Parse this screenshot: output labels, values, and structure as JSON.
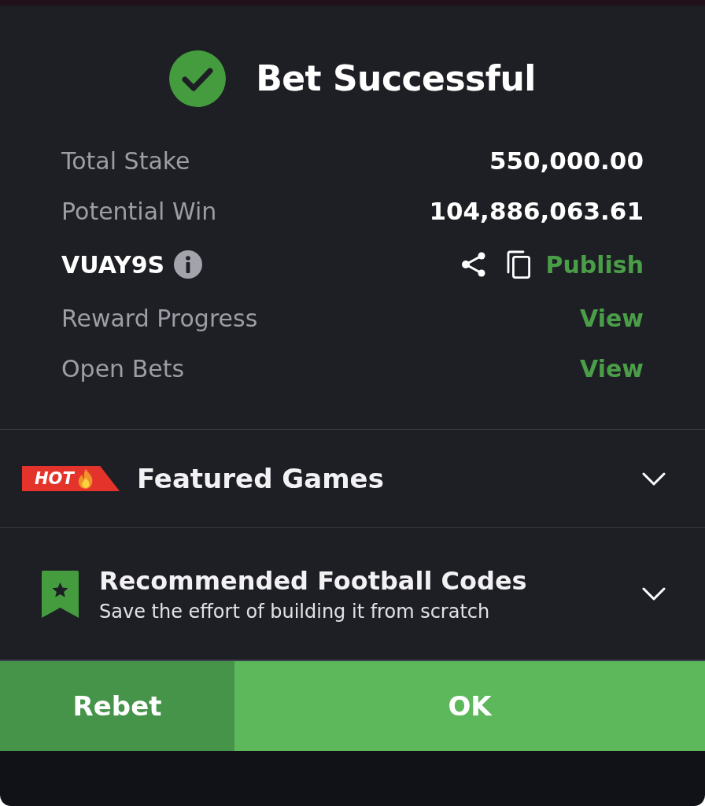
{
  "header": {
    "title": "Bet Successful"
  },
  "summary": [
    {
      "kind": "amount",
      "label": "Total Stake",
      "value": "550,000.00"
    },
    {
      "kind": "amount",
      "label": "Potential Win",
      "value": "104,886,063.61"
    },
    {
      "kind": "code",
      "label": "VUAY9S",
      "action": "Publish"
    },
    {
      "kind": "link",
      "label": "Reward Progress",
      "action": "View"
    },
    {
      "kind": "link",
      "label": "Open Bets",
      "action": "View"
    }
  ],
  "sections": [
    {
      "kind": "hot",
      "badge": "HOT",
      "title": "Featured Games",
      "expanded": false
    },
    {
      "kind": "bookmark",
      "title": "Recommended Football Codes",
      "subtitle": "Save the effort of building it from scratch",
      "expanded": false
    }
  ],
  "buttons": [
    {
      "kind": "secondary",
      "label": "Rebet"
    },
    {
      "kind": "primary",
      "label": "OK"
    }
  ]
}
